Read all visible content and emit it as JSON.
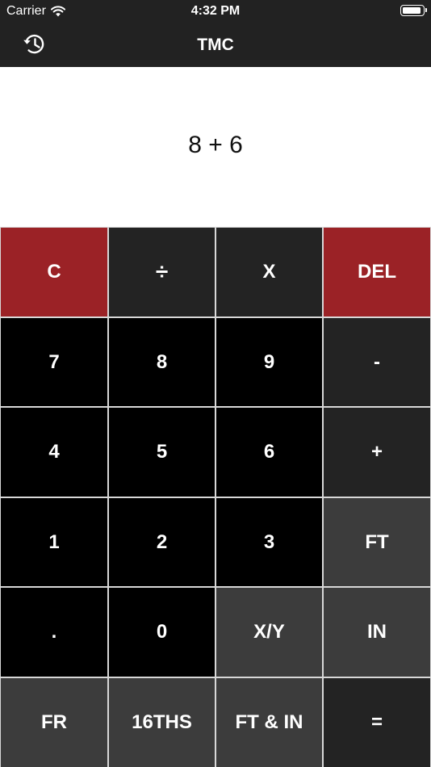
{
  "status_bar": {
    "carrier": "Carrier",
    "time": "4:32 PM"
  },
  "nav": {
    "title": "TMC",
    "history_icon": "history-icon"
  },
  "display": {
    "expression": "8 + 6"
  },
  "colors": {
    "accent_red": "#9b2226",
    "operator_dark": "#232323",
    "number_black": "#000000",
    "unit_gray": "#3c3c3c"
  },
  "keypad": {
    "row1": [
      "C",
      "÷",
      "X",
      "DEL"
    ],
    "row2": [
      "7",
      "8",
      "9",
      "-"
    ],
    "row3": [
      "4",
      "5",
      "6",
      "+"
    ],
    "row4": [
      "1",
      "2",
      "3",
      "FT"
    ],
    "row5": [
      ".",
      "0",
      "X/Y",
      "IN"
    ],
    "row6": [
      "FR",
      "16THS",
      "FT & IN",
      "="
    ]
  }
}
